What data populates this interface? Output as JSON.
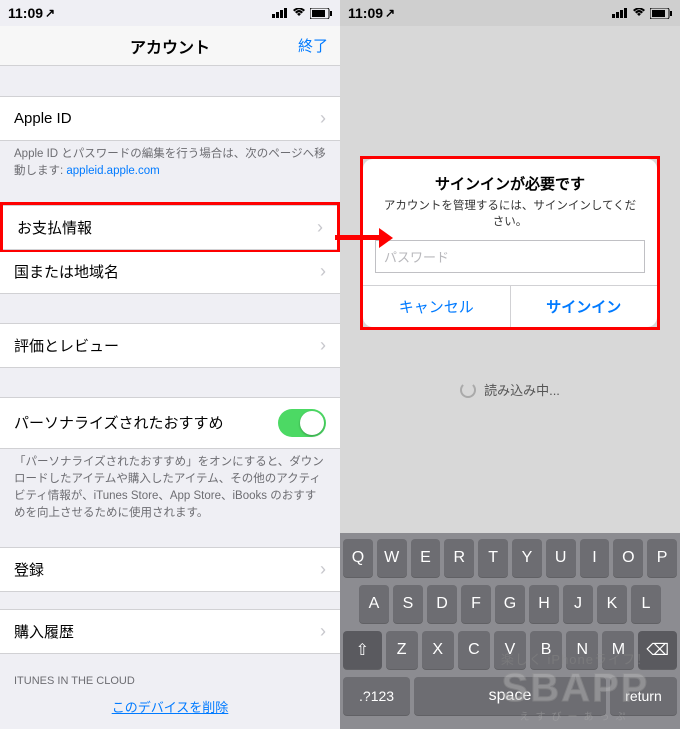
{
  "status": {
    "time": "11:09",
    "location_icon": "↗"
  },
  "left": {
    "nav": {
      "title": "アカウント",
      "done": "終了"
    },
    "rows": {
      "apple_id": "Apple ID",
      "apple_id_footer_prefix": "Apple ID とパスワードの編集を行う場合は、次のページへ移動します: ",
      "apple_id_link": "appleid.apple.com",
      "payment": "お支払情報",
      "country": "国または地域名",
      "reviews": "評価とレビュー",
      "personalized": "パーソナライズされたおすすめ",
      "personalized_footer": "「パーソナライズされたおすすめ」をオンにすると、ダウンロードしたアイテムや購入したアイテム、その他のアクティビティ情報が、iTunes Store、App Store、iBooks のおすすめを向上させるために使用されます。",
      "register": "登録",
      "purchase_history": "購入履歴",
      "itunes_cloud": "iTUNES IN THE CLOUD",
      "delete_device": "このデバイスを削除"
    }
  },
  "right": {
    "dialog": {
      "title": "サインインが必要です",
      "message": "アカウントを管理するには、サインインしてください。",
      "placeholder": "パスワード",
      "cancel": "キャンセル",
      "signin": "サインイン"
    },
    "loading": "読み込み中...",
    "keyboard": {
      "row1": [
        "Q",
        "W",
        "E",
        "R",
        "T",
        "Y",
        "U",
        "I",
        "O",
        "P"
      ],
      "row2": [
        "A",
        "S",
        "D",
        "F",
        "G",
        "H",
        "J",
        "K",
        "L"
      ],
      "row3": [
        "Z",
        "X",
        "C",
        "V",
        "B",
        "N",
        "M"
      ],
      "mode": ".?123",
      "space": "space",
      "return": "return"
    }
  },
  "watermark": {
    "top": "楽しく iPhoneライフ！",
    "mid": "SBAPP",
    "bot": "えすびーあっぷ"
  }
}
